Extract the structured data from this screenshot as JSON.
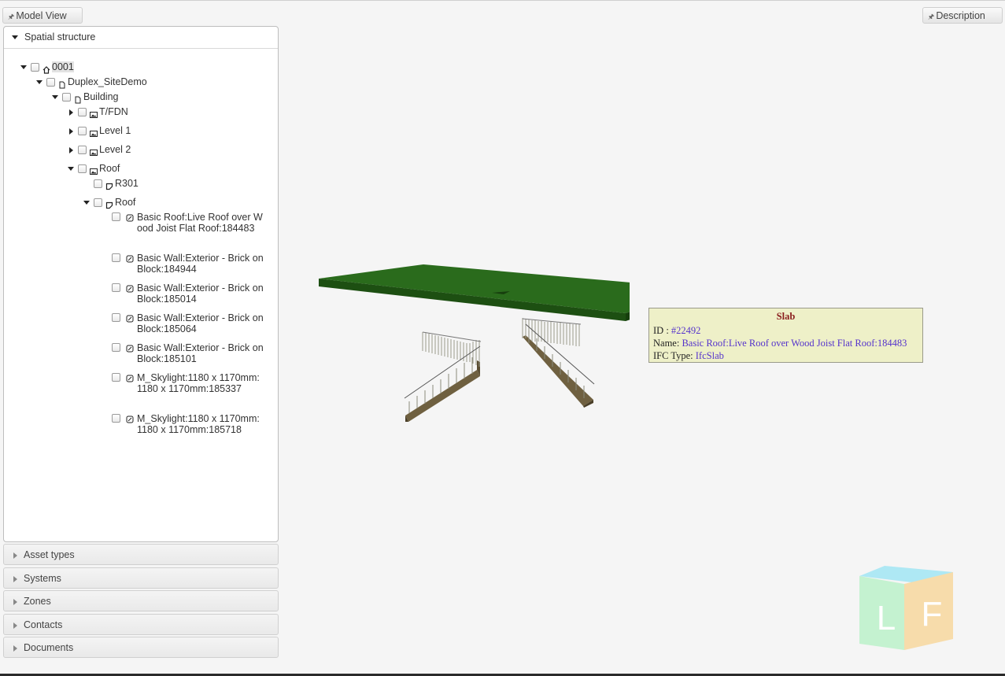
{
  "buttons": {
    "model_view": "Model View",
    "description": "Description"
  },
  "panel": {
    "title": "Spatial structure"
  },
  "tree": {
    "project": "0001",
    "site": "Duplex_SiteDemo",
    "building": "Building",
    "tfdn": "T/FDN",
    "level1": "Level 1",
    "level2": "Level 2",
    "roof_storey": "Roof",
    "r301": "R301",
    "roof_space": "Roof",
    "items": [
      "Basic Roof:Live Roof over Wood Joist Flat Roof:184483",
      "Basic Wall:Exterior - Brick on Block:184944",
      "Basic Wall:Exterior - Brick on Block:185014",
      "Basic Wall:Exterior - Brick on Block:185064",
      "Basic Wall:Exterior - Brick on Block:185101",
      "M_Skylight:1180 x 1170mm:1180 x 1170mm:185337",
      "M_Skylight:1180 x 1170mm:1180 x 1170mm:185718"
    ]
  },
  "accordion": [
    "Asset types",
    "Systems",
    "Zones",
    "Contacts",
    "Documents"
  ],
  "tooltip": {
    "title": "Slab",
    "id_label": "ID : ",
    "id_value": "#22492",
    "name_label": "Name: ",
    "name_value": "Basic Roof:Live Roof over Wood Joist Flat Roof:184483",
    "type_label": "IFC Type: ",
    "type_value": "IfcSlab"
  },
  "navcube": {
    "left": "L",
    "front": "F"
  },
  "colors": {
    "roof": "#1f5a14",
    "stair": "#7a6c44",
    "tooltip_bg": "#eef0c8",
    "link": "#5533cc"
  }
}
